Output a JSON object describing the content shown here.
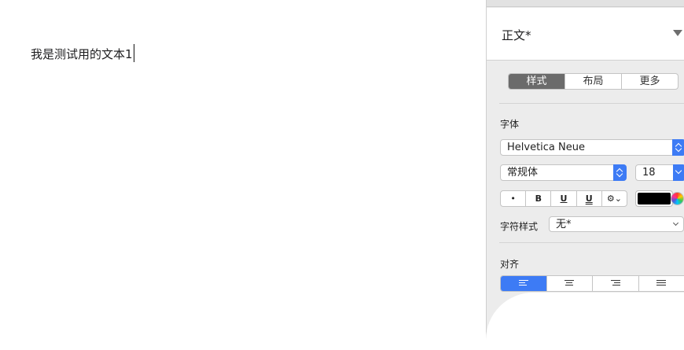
{
  "document": {
    "text": "我是测试用的文本1"
  },
  "inspector": {
    "paragraph_style": "正文*",
    "tabs": [
      {
        "label": "样式",
        "active": true
      },
      {
        "label": "布局",
        "active": false
      },
      {
        "label": "更多",
        "active": false
      }
    ],
    "font_section_label": "字体",
    "font_family": "Helvetica Neue",
    "font_typeface": "常规体",
    "font_size": "18",
    "format_buttons": [
      "•",
      "B",
      "U",
      "U",
      "⚙︎⌄"
    ],
    "text_color": "#000000",
    "char_style_label": "字符样式",
    "char_style_value": "无*",
    "align_section_label": "对齐",
    "accent_color": "#3d7bf5"
  }
}
